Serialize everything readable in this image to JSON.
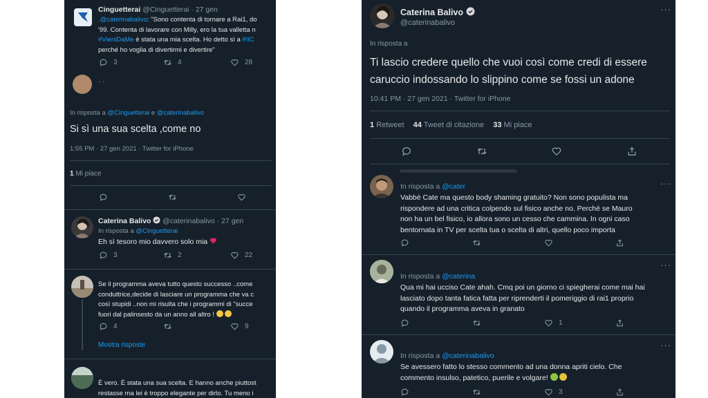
{
  "left": {
    "t1": {
      "name": "Cinguetterai",
      "handle": "@Cinguetterai",
      "sep": "·",
      "time": "27 gen",
      "lines": [
        {
          "link": ".@caterinabalivo",
          "text": ": \"Sono contenta di tornare a Rai1, do"
        },
        {
          "text": "'99. Contenta di lavorare con Milly, ero la tua valletta n"
        },
        {
          "link": "#VieniDaMe",
          "text": " è stata una mia scelta. Ho detto sì a ",
          "link2": "#IlC"
        },
        {
          "text": "perché ho voglia di divertirmi e divertire\""
        }
      ],
      "replies": "3",
      "retweets": "4",
      "likes": "28"
    },
    "main": {
      "reply_prefix": "In risposta a ",
      "reply_to1": "@Cinguetterai",
      "reply_and": " e ",
      "reply_to2": "@caterinabalivo",
      "text": "Si sì una sua scelta ,come no",
      "meta": "1:55 PM · 27 gen 2021 · Twitter for iPhone",
      "likes_count": "1",
      "likes_label": "Mi piace"
    },
    "t2": {
      "name": "Caterina Balivo",
      "handle": "@caterinabalivo",
      "sep": "·",
      "time": "27 gen",
      "reply_prefix": "In risposta a ",
      "reply_to": "@Cinguetterai",
      "text": "Eh sì tesoro mio davvero solo mia",
      "replies": "3",
      "retweets": "2",
      "likes": "22"
    },
    "t3": {
      "lines": [
        "Se il programma aveva tutto questo successo ..come",
        "conduttrice,decide di lasciare un programma che va c",
        "così stupidi ..non mi risulta che i programmi di \"succe",
        "fuori dal palinsesto da un anno all altro !"
      ],
      "replies": "4",
      "likes": "9",
      "more": "Mostra risposte"
    },
    "t4": {
      "lines": [
        "È vero. È stata una sua scelta. E hanno anche piuttost",
        "restasse ma lei è troppo elegante per dirlo. Tu meno i"
      ]
    }
  },
  "right": {
    "main": {
      "name": "Caterina Balivo",
      "handle": "@caterinabalivo",
      "reply_prefix": "In risposta a",
      "text_lines": [
        "Ti lascio credere quello che vuoi così come credi di essere",
        "caruccio indossando lo slippino come se fossi un adone"
      ],
      "meta": "10:41 PM · 27 gen 2021 · Twitter for iPhone",
      "retweets_count": "1",
      "retweets_label": "Retweet",
      "quotes_count": "44",
      "quotes_label": "Tweet di citazione",
      "likes_count": "33",
      "likes_label": "Mi piace"
    },
    "r1": {
      "reply_prefix": "In risposta a ",
      "reply_to": "@cater",
      "lines": [
        "Vabbè Cate ma questo body shaming gratuito? Non sono populista ma",
        "rispondere ad una critica colpendo sul fisico anche no. Perché se Mauro",
        "non ha un bel fisico, io allora sono un cesso che cammina. In ogni caso",
        "bentornata in TV per scelta tua o scelta di altri, quello poco importa"
      ]
    },
    "r2": {
      "reply_prefix": "In risposta a ",
      "reply_to": "@caterina",
      "lines": [
        "Qua mi hai ucciso Cate ahah. Cmq poi un giorno ci spiegherai come mai hai",
        "lasciato dopo tanta fatica fatta per riprenderti il pomeriggio di rai1 proprio",
        "quando il programma aveva in granato"
      ],
      "likes": "1"
    },
    "r3": {
      "reply_prefix": "In risposta a ",
      "reply_to": "@caterinabalivo",
      "lines": [
        "Se avessero fatto lo stesso commento ad una donna apriti cielo. Che",
        "commento insulso, patetico, puerile e volgare!"
      ],
      "likes": "3"
    }
  },
  "colors": {
    "bg": "#15202b",
    "accent": "#1d9bf0",
    "muted": "#8b98a5",
    "text": "#e7e9ea",
    "heart": "#f91880"
  }
}
